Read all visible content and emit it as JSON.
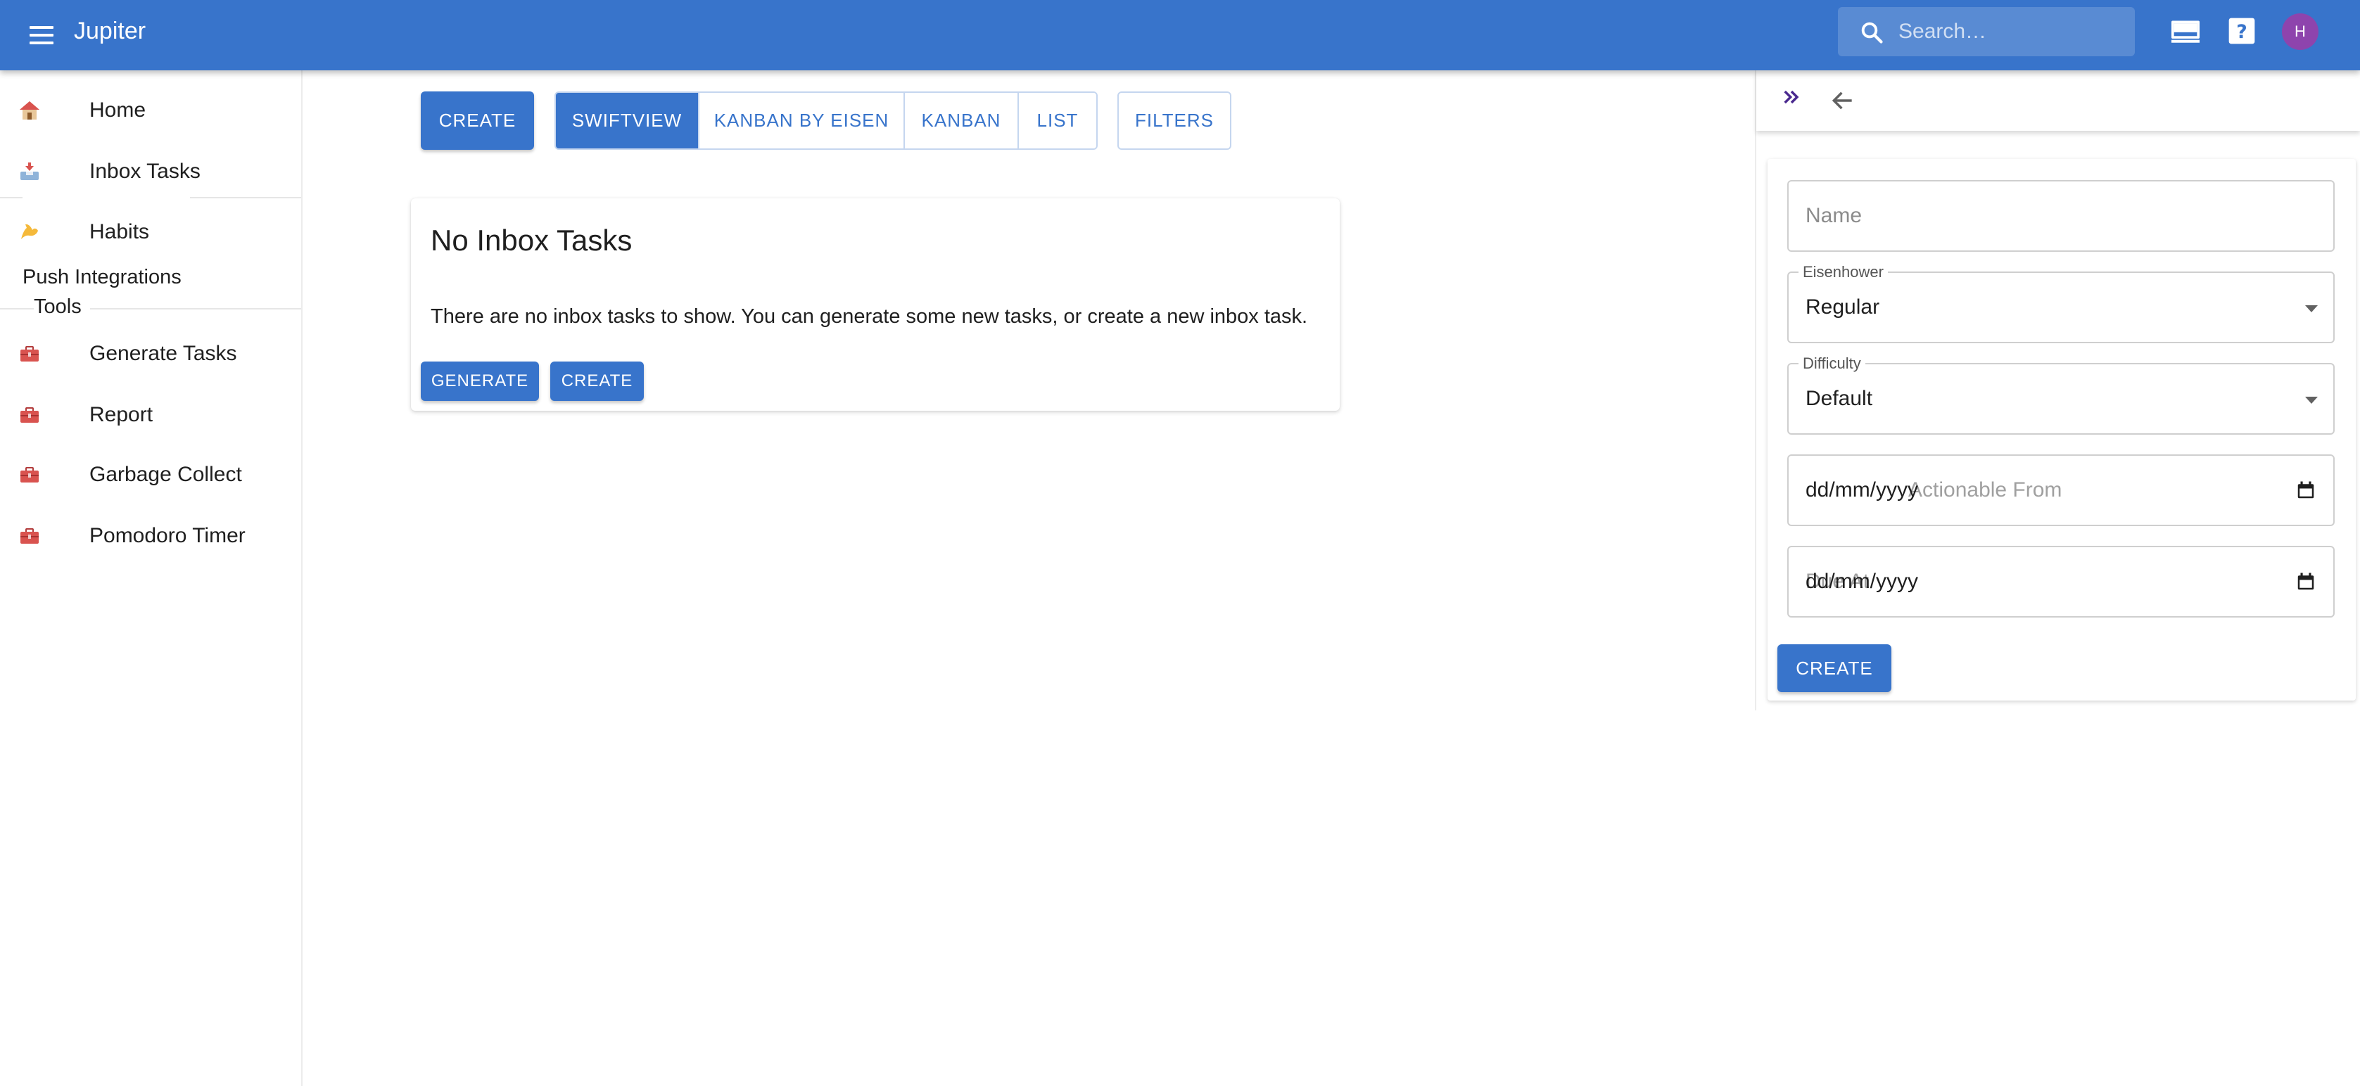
{
  "app": {
    "title": "Jupiter"
  },
  "search": {
    "placeholder": "Search…"
  },
  "user": {
    "avatar_initial": "H"
  },
  "colors": {
    "primary": "#3874cb",
    "avatar": "#8e44ad"
  },
  "sidebar": {
    "items": [
      {
        "label": "Home",
        "icon": "house-icon"
      },
      {
        "label": "Inbox Tasks",
        "icon": "inbox-tray-icon"
      },
      {
        "label": "Habits",
        "icon": "flexed-biceps-icon"
      }
    ],
    "groups": [
      {
        "label": "Push Integrations"
      },
      {
        "label": "Tools"
      }
    ],
    "tools": [
      {
        "label": "Generate Tasks",
        "icon": "toolbox-icon"
      },
      {
        "label": "Report",
        "icon": "toolbox-icon"
      },
      {
        "label": "Garbage Collect",
        "icon": "toolbox-icon"
      },
      {
        "label": "Pomodoro Timer",
        "icon": "toolbox-icon"
      }
    ]
  },
  "toolbar": {
    "create_label": "CREATE",
    "views": [
      "SWIFTVIEW",
      "KANBAN BY EISEN",
      "KANBAN",
      "LIST"
    ],
    "active_view": "SWIFTVIEW",
    "filters_label": "FILTERS"
  },
  "empty_state": {
    "title": "No Inbox Tasks",
    "message": "There are no inbox tasks to show. You can generate some new tasks, or create a new inbox task.",
    "generate_label": "GENERATE",
    "create_label": "CREATE"
  },
  "form": {
    "name_placeholder": "Name",
    "eisenhower_label": "Eisenhower",
    "eisenhower_value": "Regular",
    "difficulty_label": "Difficulty",
    "difficulty_value": "Default",
    "actionable_from_value": "dd/mm/yyyy",
    "actionable_from_placeholder": "Actionable From",
    "due_date_value": "dd/mm/yyyy",
    "due_date_placeholder": "Due At",
    "create_label": "CREATE"
  }
}
